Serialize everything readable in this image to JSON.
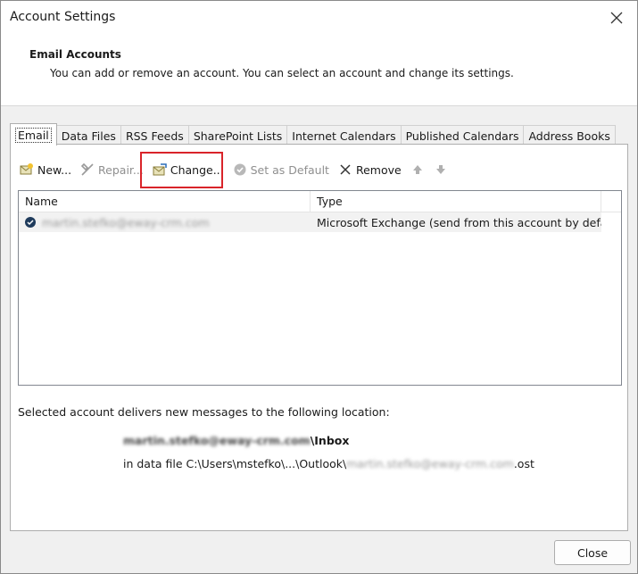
{
  "window": {
    "title": "Account Settings"
  },
  "header": {
    "title": "Email Accounts",
    "description": "You can add or remove an account. You can select an account and change its settings."
  },
  "tabs": [
    {
      "label": "Email",
      "active": true
    },
    {
      "label": "Data Files"
    },
    {
      "label": "RSS Feeds"
    },
    {
      "label": "SharePoint Lists"
    },
    {
      "label": "Internet Calendars"
    },
    {
      "label": "Published Calendars"
    },
    {
      "label": "Address Books"
    }
  ],
  "toolbar": {
    "new_label": "New...",
    "repair_label": "Repair...",
    "change_label": "Change...",
    "set_default_label": "Set as Default",
    "remove_label": "Remove"
  },
  "list": {
    "columns": [
      "Name",
      "Type"
    ],
    "rows": [
      {
        "name": "martin.stefko@eway-crm.com",
        "type": "Microsoft Exchange (send from this account by defa..."
      }
    ]
  },
  "delivery": {
    "label": "Selected account delivers new messages to the following location:",
    "account": "martin.stefko@eway-crm.com",
    "folder": "\\Inbox",
    "file_prefix": "in data file C:\\Users\\mstefko\\...\\Outlook\\",
    "file_account": "martin.stefko@eway-crm.com",
    "file_ext": ".ost"
  },
  "footer": {
    "close_label": "Close"
  },
  "colors": {
    "highlight": "#d9242a",
    "accent": "#1a73c9"
  }
}
